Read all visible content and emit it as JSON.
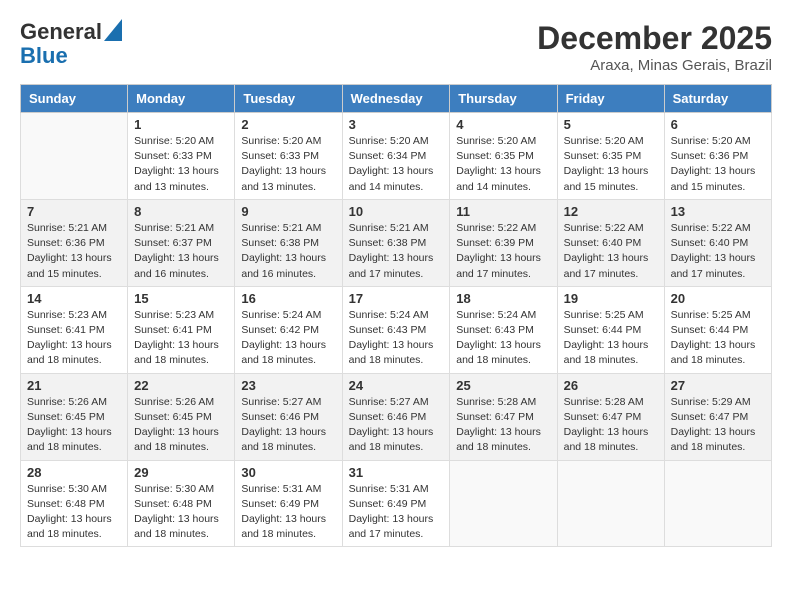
{
  "header": {
    "logo_line1": "General",
    "logo_line2": "Blue",
    "month": "December 2025",
    "location": "Araxa, Minas Gerais, Brazil"
  },
  "weekdays": [
    "Sunday",
    "Monday",
    "Tuesday",
    "Wednesday",
    "Thursday",
    "Friday",
    "Saturday"
  ],
  "weeks": [
    [
      {
        "day": "",
        "info": ""
      },
      {
        "day": "1",
        "info": "Sunrise: 5:20 AM\nSunset: 6:33 PM\nDaylight: 13 hours\nand 13 minutes."
      },
      {
        "day": "2",
        "info": "Sunrise: 5:20 AM\nSunset: 6:33 PM\nDaylight: 13 hours\nand 13 minutes."
      },
      {
        "day": "3",
        "info": "Sunrise: 5:20 AM\nSunset: 6:34 PM\nDaylight: 13 hours\nand 14 minutes."
      },
      {
        "day": "4",
        "info": "Sunrise: 5:20 AM\nSunset: 6:35 PM\nDaylight: 13 hours\nand 14 minutes."
      },
      {
        "day": "5",
        "info": "Sunrise: 5:20 AM\nSunset: 6:35 PM\nDaylight: 13 hours\nand 15 minutes."
      },
      {
        "day": "6",
        "info": "Sunrise: 5:20 AM\nSunset: 6:36 PM\nDaylight: 13 hours\nand 15 minutes."
      }
    ],
    [
      {
        "day": "7",
        "info": "Sunrise: 5:21 AM\nSunset: 6:36 PM\nDaylight: 13 hours\nand 15 minutes."
      },
      {
        "day": "8",
        "info": "Sunrise: 5:21 AM\nSunset: 6:37 PM\nDaylight: 13 hours\nand 16 minutes."
      },
      {
        "day": "9",
        "info": "Sunrise: 5:21 AM\nSunset: 6:38 PM\nDaylight: 13 hours\nand 16 minutes."
      },
      {
        "day": "10",
        "info": "Sunrise: 5:21 AM\nSunset: 6:38 PM\nDaylight: 13 hours\nand 17 minutes."
      },
      {
        "day": "11",
        "info": "Sunrise: 5:22 AM\nSunset: 6:39 PM\nDaylight: 13 hours\nand 17 minutes."
      },
      {
        "day": "12",
        "info": "Sunrise: 5:22 AM\nSunset: 6:40 PM\nDaylight: 13 hours\nand 17 minutes."
      },
      {
        "day": "13",
        "info": "Sunrise: 5:22 AM\nSunset: 6:40 PM\nDaylight: 13 hours\nand 17 minutes."
      }
    ],
    [
      {
        "day": "14",
        "info": "Sunrise: 5:23 AM\nSunset: 6:41 PM\nDaylight: 13 hours\nand 18 minutes."
      },
      {
        "day": "15",
        "info": "Sunrise: 5:23 AM\nSunset: 6:41 PM\nDaylight: 13 hours\nand 18 minutes."
      },
      {
        "day": "16",
        "info": "Sunrise: 5:24 AM\nSunset: 6:42 PM\nDaylight: 13 hours\nand 18 minutes."
      },
      {
        "day": "17",
        "info": "Sunrise: 5:24 AM\nSunset: 6:43 PM\nDaylight: 13 hours\nand 18 minutes."
      },
      {
        "day": "18",
        "info": "Sunrise: 5:24 AM\nSunset: 6:43 PM\nDaylight: 13 hours\nand 18 minutes."
      },
      {
        "day": "19",
        "info": "Sunrise: 5:25 AM\nSunset: 6:44 PM\nDaylight: 13 hours\nand 18 minutes."
      },
      {
        "day": "20",
        "info": "Sunrise: 5:25 AM\nSunset: 6:44 PM\nDaylight: 13 hours\nand 18 minutes."
      }
    ],
    [
      {
        "day": "21",
        "info": "Sunrise: 5:26 AM\nSunset: 6:45 PM\nDaylight: 13 hours\nand 18 minutes."
      },
      {
        "day": "22",
        "info": "Sunrise: 5:26 AM\nSunset: 6:45 PM\nDaylight: 13 hours\nand 18 minutes."
      },
      {
        "day": "23",
        "info": "Sunrise: 5:27 AM\nSunset: 6:46 PM\nDaylight: 13 hours\nand 18 minutes."
      },
      {
        "day": "24",
        "info": "Sunrise: 5:27 AM\nSunset: 6:46 PM\nDaylight: 13 hours\nand 18 minutes."
      },
      {
        "day": "25",
        "info": "Sunrise: 5:28 AM\nSunset: 6:47 PM\nDaylight: 13 hours\nand 18 minutes."
      },
      {
        "day": "26",
        "info": "Sunrise: 5:28 AM\nSunset: 6:47 PM\nDaylight: 13 hours\nand 18 minutes."
      },
      {
        "day": "27",
        "info": "Sunrise: 5:29 AM\nSunset: 6:47 PM\nDaylight: 13 hours\nand 18 minutes."
      }
    ],
    [
      {
        "day": "28",
        "info": "Sunrise: 5:30 AM\nSunset: 6:48 PM\nDaylight: 13 hours\nand 18 minutes."
      },
      {
        "day": "29",
        "info": "Sunrise: 5:30 AM\nSunset: 6:48 PM\nDaylight: 13 hours\nand 18 minutes."
      },
      {
        "day": "30",
        "info": "Sunrise: 5:31 AM\nSunset: 6:49 PM\nDaylight: 13 hours\nand 18 minutes."
      },
      {
        "day": "31",
        "info": "Sunrise: 5:31 AM\nSunset: 6:49 PM\nDaylight: 13 hours\nand 17 minutes."
      },
      {
        "day": "",
        "info": ""
      },
      {
        "day": "",
        "info": ""
      },
      {
        "day": "",
        "info": ""
      }
    ]
  ]
}
